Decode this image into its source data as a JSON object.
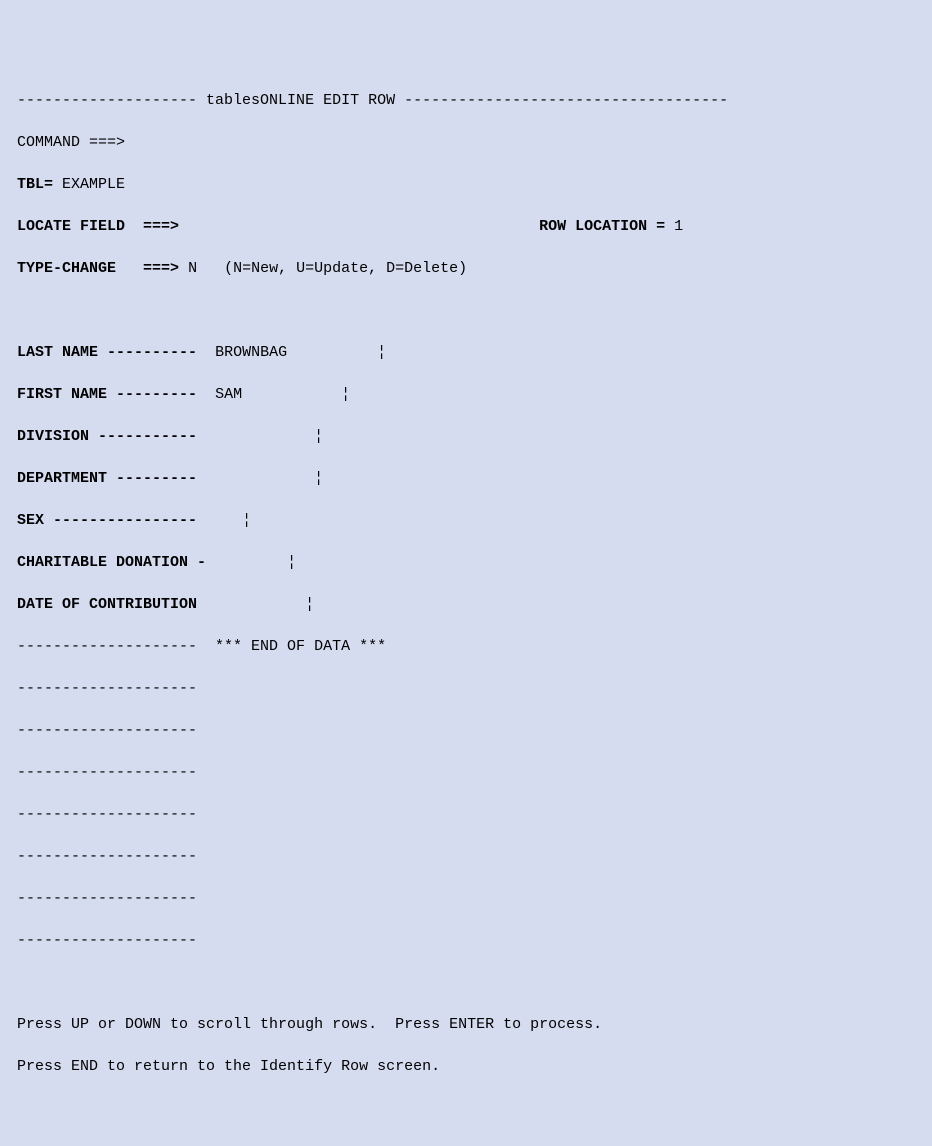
{
  "title": "tablesONLINE EDIT ROW",
  "command_label": "COMMAND ===>",
  "command_value": "",
  "tbl_label": "TBL=",
  "tbl_value": "EXAMPLE",
  "locate_field_label": "LOCATE FIELD  ===>",
  "locate_field_value": "",
  "row_location_label": "ROW LOCATION =",
  "row_location_value": "1",
  "type_change_label": "TYPE-CHANGE   ===>",
  "type_change_value": "N",
  "type_change_hint": "(N=New, U=Update, D=Delete)",
  "fields": {
    "last_name": {
      "label": "LAST NAME ----------",
      "value": "BROWNBAG          ¦"
    },
    "first_name": {
      "label": "FIRST NAME ---------",
      "value": "SAM           ¦"
    },
    "division": {
      "label": "DIVISION -----------",
      "value": "           ¦"
    },
    "department": {
      "label": "DEPARTMENT ---------",
      "value": "           ¦"
    },
    "sex": {
      "label": "SEX ----------------",
      "value": "   ¦"
    },
    "charitable": {
      "label": "CHARITABLE DONATION -",
      "value": "        ¦"
    },
    "date": {
      "label": "DATE OF CONTRIBUTION",
      "value": "          ¦"
    }
  },
  "end_of_data_dashes": " --------------------",
  "end_of_data": "*** END OF DATA ***",
  "blank_dashes": " --------------------",
  "footer_line1": "Press UP or DOWN to scroll through rows.  Press ENTER to process.",
  "footer_line2": "Press END to return to the Identify Row screen."
}
